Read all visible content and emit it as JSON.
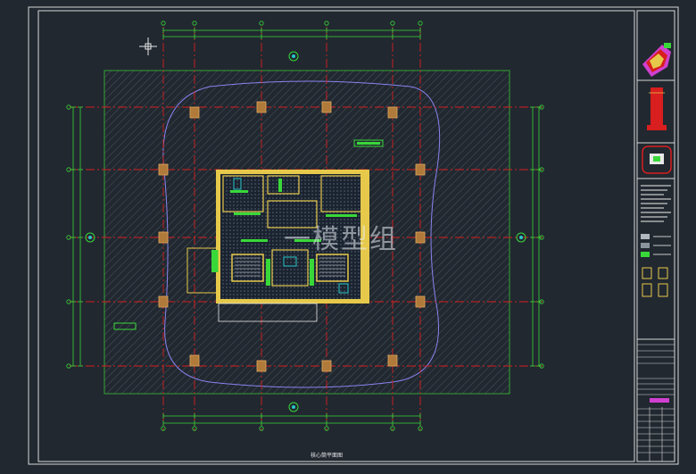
{
  "watermark": "一模型组",
  "drawing_label": "核心筒平面图",
  "colors": {
    "background": "#212830",
    "frame": "#d8d8d8",
    "slab": "#35a235",
    "grid_line": "#d81e1e",
    "dimension": "#39d839",
    "boundary": "#8a84f0",
    "core_wall": "#e6c94a",
    "column": "#b07a3a",
    "cyan": "#28c8c8",
    "magenta": "#d040d0"
  },
  "icons": [
    "crosshair-icon",
    "north-arrow-icon",
    "key-plan-icon",
    "section-elevation-icon",
    "location-plan-icon"
  ],
  "title_block": {
    "notes_heading": "说明",
    "project_label": "项目",
    "drawing_no_label": "图号"
  }
}
